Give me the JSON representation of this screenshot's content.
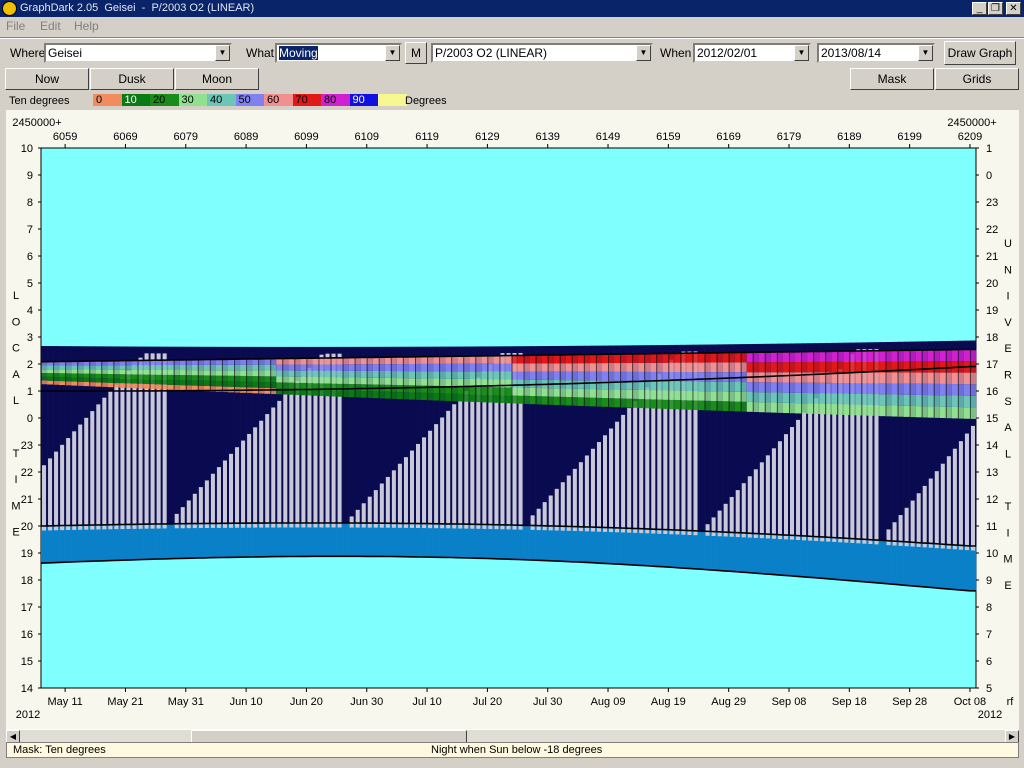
{
  "window": {
    "title": "GraphDark 2.05  Geisei  -  P/2003 O2 (LINEAR)"
  },
  "menu": [
    "File",
    "Edit",
    "Help"
  ],
  "toolbar": {
    "where_label": "Where",
    "where_value": "Geisei",
    "what_label": "What",
    "what_value": "Moving",
    "m_button": "M",
    "object_value": "P/2003 O2 (LINEAR)",
    "when_label": "When",
    "start_date": "2012/02/01",
    "end_date": "2013/08/14",
    "draw_button": "Draw Graph"
  },
  "buttons": {
    "now": "Now",
    "dusk": "Dusk",
    "moon": "Moon",
    "mask": "Mask",
    "grids": "Grids"
  },
  "legend": {
    "title": "Ten degrees",
    "units": "Degrees",
    "items": [
      {
        "label": "0",
        "color": "#f08c60"
      },
      {
        "label": "10",
        "color": "#0a7a14"
      },
      {
        "label": "20",
        "color": "#1a8c1a"
      },
      {
        "label": "30",
        "color": "#90e090"
      },
      {
        "label": "40",
        "color": "#6cc6b8"
      },
      {
        "label": "50",
        "color": "#8080f0"
      },
      {
        "label": "60",
        "color": "#f09090"
      },
      {
        "label": "70",
        "color": "#e01818"
      },
      {
        "label": "80",
        "color": "#d020d0"
      },
      {
        "label": "90",
        "color": "#1010e0"
      },
      {
        "label": "",
        "color": "#f8f890"
      }
    ]
  },
  "chart_data": {
    "type": "heatmap",
    "jd_prefix_left": "2450000+",
    "jd_prefix_right": "2450000+",
    "jd_ticks": [
      "6059",
      "6069",
      "6079",
      "6089",
      "6099",
      "6109",
      "6119",
      "6129",
      "6139",
      "6149",
      "6159",
      "6169",
      "6179",
      "6189",
      "6199",
      "6209"
    ],
    "date_ticks": [
      "May 11",
      "May 21",
      "May 31",
      "Jun 10",
      "Jun 20",
      "Jun 30",
      "Jul 10",
      "Jul 20",
      "Jul 30",
      "Aug 09",
      "Aug 19",
      "Aug 29",
      "Sep 08",
      "Sep 18",
      "Sep 28",
      "Oct 08"
    ],
    "year_left": "2012",
    "year_right": "2012",
    "right_corner": "rf",
    "left_axis_ticks": [
      "10",
      "9",
      "8",
      "7",
      "6",
      "5",
      "4",
      "3",
      "2",
      "1",
      "0",
      "23",
      "22",
      "21",
      "20",
      "19",
      "18",
      "17",
      "16",
      "15",
      "14"
    ],
    "right_axis_ticks": [
      "1",
      "0",
      "23",
      "22",
      "21",
      "20",
      "19",
      "18",
      "17",
      "16",
      "15",
      "14",
      "13",
      "12",
      "11",
      "10",
      "9",
      "8",
      "7",
      "6",
      "5"
    ],
    "left_axis_title": [
      "L",
      "O",
      "C",
      "A",
      "L",
      "",
      "T",
      "I",
      "M",
      "E"
    ],
    "right_axis_title": [
      "U",
      "N",
      "I",
      "V",
      "E",
      "R",
      "S",
      "A",
      "L",
      "",
      "T",
      "I",
      "M",
      "E"
    ],
    "colors": {
      "day": "#80ffff",
      "twilight": "#0a80c8",
      "night": "#0a0a50",
      "moon": "#c8c8d8"
    },
    "xlim": [
      6055,
      6210
    ],
    "ylim_local_hours": [
      14,
      38
    ]
  },
  "status": {
    "mask": "Mask:  Ten degrees",
    "night": "Night when Sun below -18 degrees"
  }
}
